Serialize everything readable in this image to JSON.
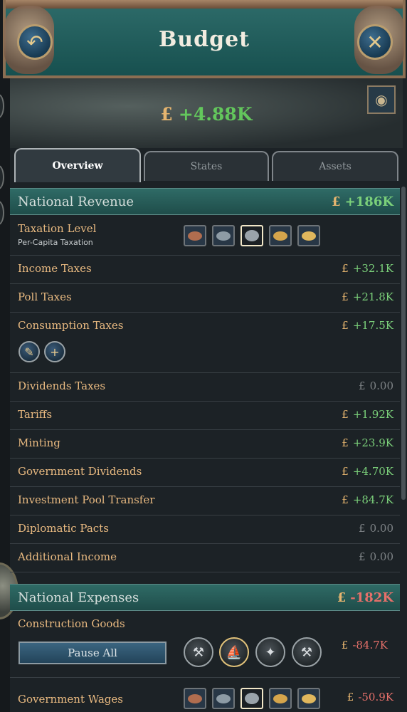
{
  "window": {
    "title": "Budget",
    "back_icon": "undo-arrow-icon",
    "close_icon": "close-x-icon",
    "back_glyph": "↶",
    "close_glyph": "✕"
  },
  "summary": {
    "currency": "£",
    "net_balance": "+4.88K",
    "map_glyph": "◉"
  },
  "tabs": [
    {
      "label": "Overview",
      "active": true
    },
    {
      "label": "States",
      "active": false
    },
    {
      "label": "Assets",
      "active": false
    }
  ],
  "revenue": {
    "title": "National Revenue",
    "total": "+186K",
    "taxation": {
      "label": "Taxation Level",
      "sublabel": "Per-Capita Taxation",
      "selected_index": 2
    },
    "rows": [
      {
        "label": "Income Taxes",
        "value": "+32.1K",
        "tone": "pos"
      },
      {
        "label": "Poll Taxes",
        "value": "+21.8K",
        "tone": "pos"
      },
      {
        "label": "Consumption Taxes",
        "value": "+17.5K",
        "tone": "pos"
      },
      {
        "label": "Dividends Taxes",
        "value": "0.00",
        "tone": "zero"
      },
      {
        "label": "Tariffs",
        "value": "+1.92K",
        "tone": "pos"
      },
      {
        "label": "Minting",
        "value": "+23.9K",
        "tone": "pos"
      },
      {
        "label": "Government Dividends",
        "value": "+4.70K",
        "tone": "pos"
      },
      {
        "label": "Investment Pool Transfer",
        "value": "+84.7K",
        "tone": "pos"
      },
      {
        "label": "Diplomatic Pacts",
        "value": "0.00",
        "tone": "zero"
      },
      {
        "label": "Additional Income",
        "value": "0.00",
        "tone": "zero"
      }
    ],
    "consumption_buttons": {
      "goods_glyph": "✎",
      "add_glyph": "+"
    }
  },
  "expenses": {
    "title": "National Expenses",
    "total": "-182K",
    "construction": {
      "label": "Construction Goods",
      "value": "-84.7K",
      "pause_label": "Pause All",
      "icons": [
        {
          "name": "tools-icon",
          "glyph": "⚒",
          "selected": false
        },
        {
          "name": "ship-icon",
          "glyph": "⛵",
          "selected": true
        },
        {
          "name": "bird-icon",
          "glyph": "✦",
          "selected": false
        },
        {
          "name": "hammer-icon",
          "glyph": "⚒",
          "selected": false
        }
      ]
    },
    "wages": {
      "label": "Government Wages",
      "value": "-50.9K",
      "selected_index": 2
    }
  }
}
